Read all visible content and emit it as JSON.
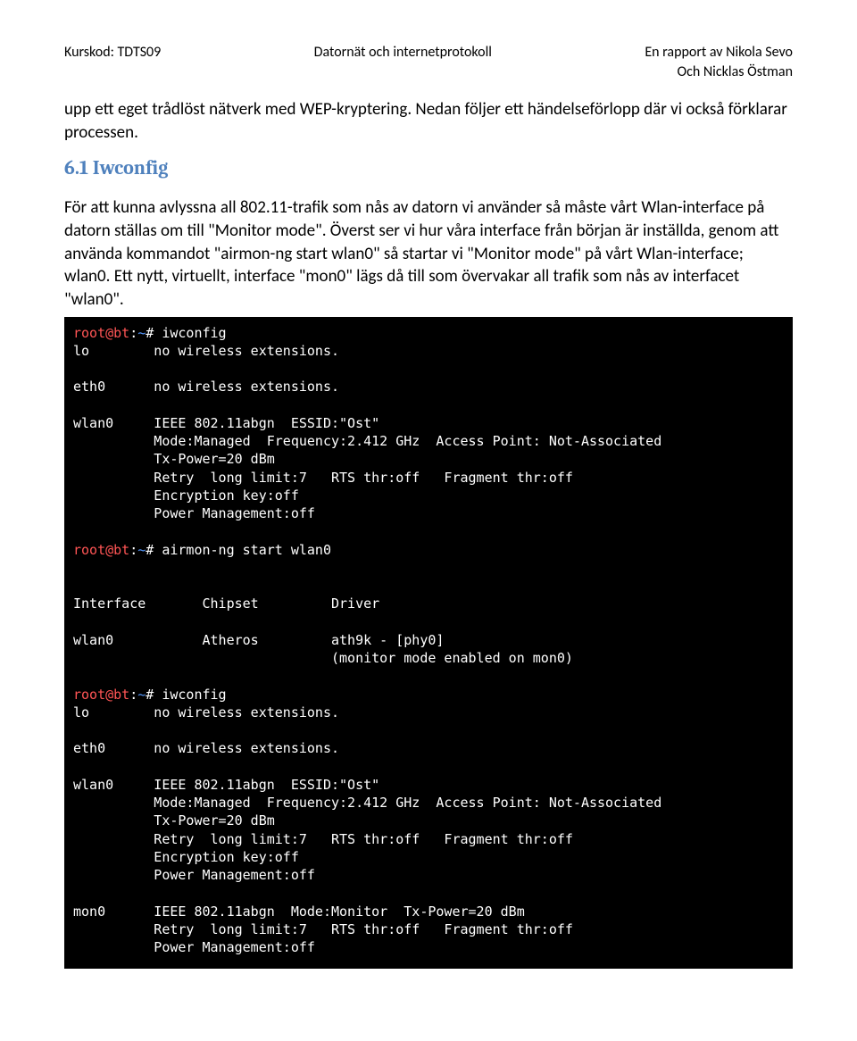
{
  "header": {
    "left": "Kurskod: TDTS09",
    "center": "Datornät och internetprotokoll",
    "right_line1": "En rapport av Nikola Sevo",
    "right_line2": "Och Nicklas Östman"
  },
  "intro_paragraph": "upp ett eget trådlöst nätverk med WEP-kryptering. Nedan följer ett händelseförlopp där vi också förklarar processen.",
  "section": {
    "heading": "6.1 Iwconfig",
    "paragraph": "För att kunna avlyssna all 802.11-trafik som nås av datorn vi använder så måste vårt Wlan-interface på datorn ställas om till \"Monitor mode\". Överst ser vi hur våra interface från början är inställda, genom att använda kommandot \"airmon-ng start wlan0\" så startar vi \"Monitor mode\" på vårt Wlan-interface; wlan0. Ett nytt, virtuellt, interface \"mon0\" lägs då till som övervakar all trafik som nås av interfacet \"wlan0\"."
  },
  "terminal": {
    "prompt": {
      "user_host": "root@bt",
      "colon": ":",
      "path": "~",
      "hash": "#"
    },
    "cmd1": " iwconfig",
    "cmd2": " airmon-ng start wlan0",
    "cmd3": " iwconfig",
    "block1": [
      "lo        no wireless extensions.",
      "",
      "eth0      no wireless extensions.",
      "",
      "wlan0     IEEE 802.11abgn  ESSID:\"Ost\"",
      "          Mode:Managed  Frequency:2.412 GHz  Access Point: Not-Associated",
      "          Tx-Power=20 dBm",
      "          Retry  long limit:7   RTS thr:off   Fragment thr:off",
      "          Encryption key:off",
      "          Power Management:off",
      ""
    ],
    "block2": [
      "",
      "",
      "Interface       Chipset         Driver",
      "",
      "wlan0           Atheros         ath9k - [phy0]",
      "                                (monitor mode enabled on mon0)",
      ""
    ],
    "block3": [
      "lo        no wireless extensions.",
      "",
      "eth0      no wireless extensions.",
      "",
      "wlan0     IEEE 802.11abgn  ESSID:\"Ost\"",
      "          Mode:Managed  Frequency:2.412 GHz  Access Point: Not-Associated",
      "          Tx-Power=20 dBm",
      "          Retry  long limit:7   RTS thr:off   Fragment thr:off",
      "          Encryption key:off",
      "          Power Management:off",
      "",
      "mon0      IEEE 802.11abgn  Mode:Monitor  Tx-Power=20 dBm",
      "          Retry  long limit:7   RTS thr:off   Fragment thr:off",
      "          Power Management:off"
    ]
  }
}
